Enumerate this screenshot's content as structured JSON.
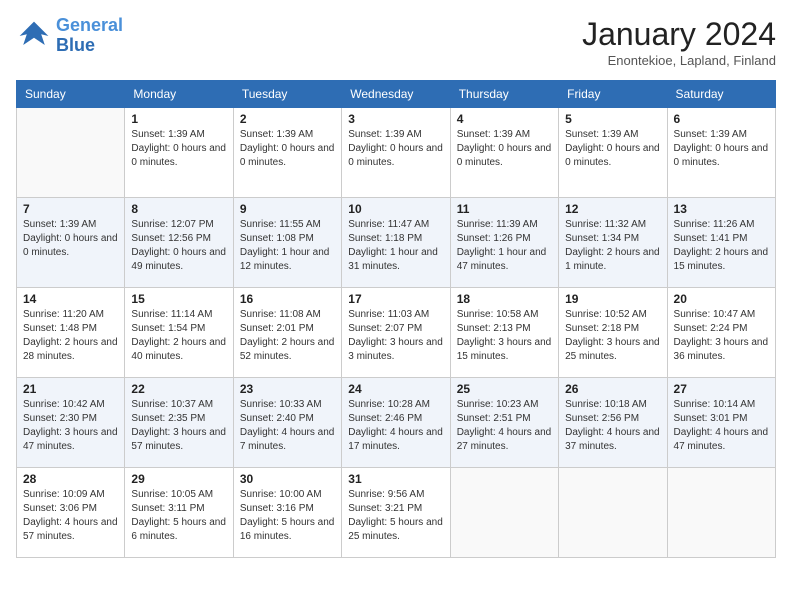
{
  "logo": {
    "line1": "General",
    "line2": "Blue"
  },
  "title": "January 2024",
  "subtitle": "Enontekioe, Lapland, Finland",
  "days_of_week": [
    "Sunday",
    "Monday",
    "Tuesday",
    "Wednesday",
    "Thursday",
    "Friday",
    "Saturday"
  ],
  "weeks": [
    [
      {
        "day": "",
        "info": ""
      },
      {
        "day": "1",
        "info": "Sunset: 1:39 AM\nDaylight: 0 hours and 0 minutes."
      },
      {
        "day": "2",
        "info": "Sunset: 1:39 AM\nDaylight: 0 hours and 0 minutes."
      },
      {
        "day": "3",
        "info": "Sunset: 1:39 AM\nDaylight: 0 hours and 0 minutes."
      },
      {
        "day": "4",
        "info": "Sunset: 1:39 AM\nDaylight: 0 hours and 0 minutes."
      },
      {
        "day": "5",
        "info": "Sunset: 1:39 AM\nDaylight: 0 hours and 0 minutes."
      },
      {
        "day": "6",
        "info": "Sunset: 1:39 AM\nDaylight: 0 hours and 0 minutes."
      }
    ],
    [
      {
        "day": "7",
        "info": "Sunset: 1:39 AM\nDaylight: 0 hours and 0 minutes."
      },
      {
        "day": "8",
        "info": "Sunrise: 12:07 PM\nSunset: 12:56 PM\nDaylight: 0 hours and 49 minutes."
      },
      {
        "day": "9",
        "info": "Sunrise: 11:55 AM\nSunset: 1:08 PM\nDaylight: 1 hour and 12 minutes."
      },
      {
        "day": "10",
        "info": "Sunrise: 11:47 AM\nSunset: 1:18 PM\nDaylight: 1 hour and 31 minutes."
      },
      {
        "day": "11",
        "info": "Sunrise: 11:39 AM\nSunset: 1:26 PM\nDaylight: 1 hour and 47 minutes."
      },
      {
        "day": "12",
        "info": "Sunrise: 11:32 AM\nSunset: 1:34 PM\nDaylight: 2 hours and 1 minute."
      },
      {
        "day": "13",
        "info": "Sunrise: 11:26 AM\nSunset: 1:41 PM\nDaylight: 2 hours and 15 minutes."
      }
    ],
    [
      {
        "day": "14",
        "info": "Sunrise: 11:20 AM\nSunset: 1:48 PM\nDaylight: 2 hours and 28 minutes."
      },
      {
        "day": "15",
        "info": "Sunrise: 11:14 AM\nSunset: 1:54 PM\nDaylight: 2 hours and 40 minutes."
      },
      {
        "day": "16",
        "info": "Sunrise: 11:08 AM\nSunset: 2:01 PM\nDaylight: 2 hours and 52 minutes."
      },
      {
        "day": "17",
        "info": "Sunrise: 11:03 AM\nSunset: 2:07 PM\nDaylight: 3 hours and 3 minutes."
      },
      {
        "day": "18",
        "info": "Sunrise: 10:58 AM\nSunset: 2:13 PM\nDaylight: 3 hours and 15 minutes."
      },
      {
        "day": "19",
        "info": "Sunrise: 10:52 AM\nSunset: 2:18 PM\nDaylight: 3 hours and 25 minutes."
      },
      {
        "day": "20",
        "info": "Sunrise: 10:47 AM\nSunset: 2:24 PM\nDaylight: 3 hours and 36 minutes."
      }
    ],
    [
      {
        "day": "21",
        "info": "Sunrise: 10:42 AM\nSunset: 2:30 PM\nDaylight: 3 hours and 47 minutes."
      },
      {
        "day": "22",
        "info": "Sunrise: 10:37 AM\nSunset: 2:35 PM\nDaylight: 3 hours and 57 minutes."
      },
      {
        "day": "23",
        "info": "Sunrise: 10:33 AM\nSunset: 2:40 PM\nDaylight: 4 hours and 7 minutes."
      },
      {
        "day": "24",
        "info": "Sunrise: 10:28 AM\nSunset: 2:46 PM\nDaylight: 4 hours and 17 minutes."
      },
      {
        "day": "25",
        "info": "Sunrise: 10:23 AM\nSunset: 2:51 PM\nDaylight: 4 hours and 27 minutes."
      },
      {
        "day": "26",
        "info": "Sunrise: 10:18 AM\nSunset: 2:56 PM\nDaylight: 4 hours and 37 minutes."
      },
      {
        "day": "27",
        "info": "Sunrise: 10:14 AM\nSunset: 3:01 PM\nDaylight: 4 hours and 47 minutes."
      }
    ],
    [
      {
        "day": "28",
        "info": "Sunrise: 10:09 AM\nSunset: 3:06 PM\nDaylight: 4 hours and 57 minutes."
      },
      {
        "day": "29",
        "info": "Sunrise: 10:05 AM\nSunset: 3:11 PM\nDaylight: 5 hours and 6 minutes."
      },
      {
        "day": "30",
        "info": "Sunrise: 10:00 AM\nSunset: 3:16 PM\nDaylight: 5 hours and 16 minutes."
      },
      {
        "day": "31",
        "info": "Sunrise: 9:56 AM\nSunset: 3:21 PM\nDaylight: 5 hours and 25 minutes."
      },
      {
        "day": "",
        "info": ""
      },
      {
        "day": "",
        "info": ""
      },
      {
        "day": "",
        "info": ""
      }
    ]
  ]
}
